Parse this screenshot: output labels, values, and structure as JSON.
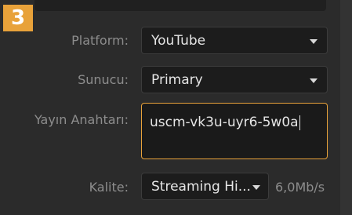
{
  "step": {
    "number": "3"
  },
  "form": {
    "platform": {
      "label": "Platform:",
      "value": "YouTube",
      "caret_icon": "chevron-down-icon"
    },
    "server": {
      "label": "Sunucu:",
      "value": "Primary",
      "caret_icon": "chevron-down-icon"
    },
    "stream_key": {
      "label": "Yayın Anahtarı:",
      "value": "uscm-vk3u-uyr6-5w0a"
    },
    "quality": {
      "label": "Kalite:",
      "value": "Streaming Hi...",
      "bitrate": "6,0Mb/s",
      "caret_icon": "chevron-down-icon"
    }
  },
  "colors": {
    "accent": "#e8a23a",
    "panel": "#2b2b2b",
    "field": "#1c1c1c"
  }
}
